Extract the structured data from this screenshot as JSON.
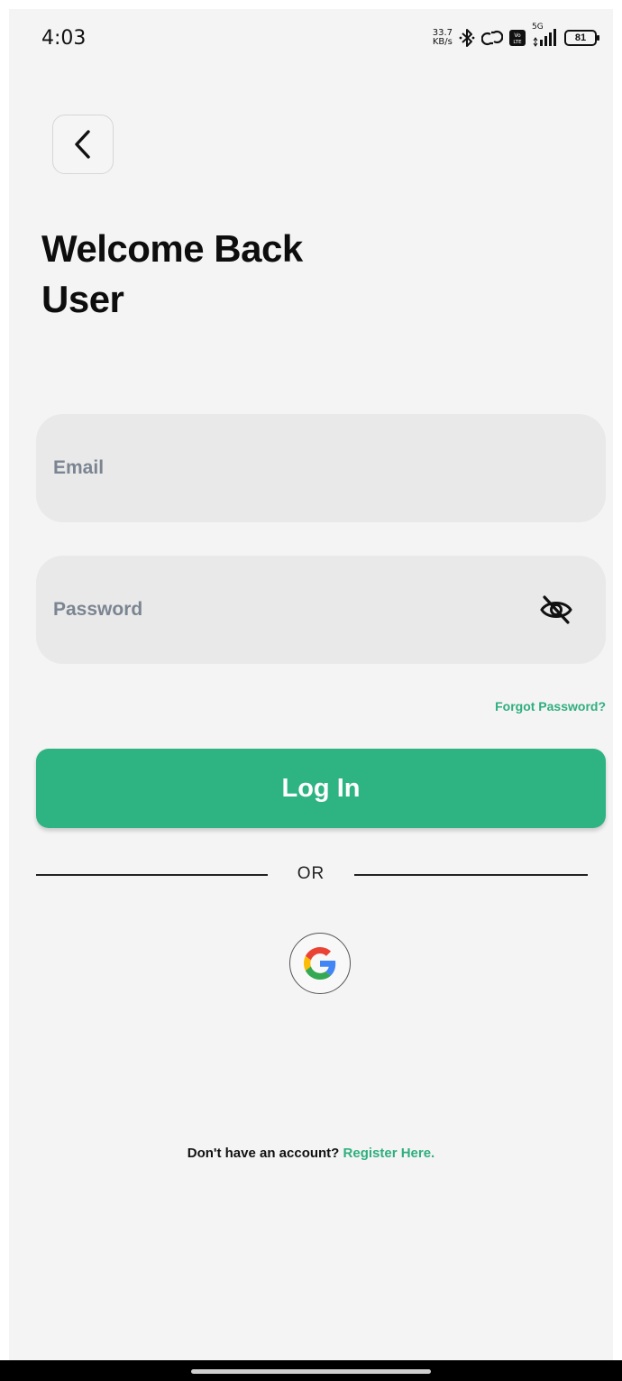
{
  "status_bar": {
    "time": "4:03",
    "net_speed_value": "33.7",
    "net_speed_unit": "KB/s",
    "signal_type": "5G",
    "battery": "81",
    "icons": [
      "bluetooth-icon",
      "hotspot-link-icon",
      "volte-icon",
      "signal-icon",
      "battery-icon"
    ]
  },
  "header": {
    "back_icon": "chevron-left-icon",
    "title_line1": "Welcome Back",
    "title_line2": "User"
  },
  "form": {
    "email_placeholder": "Email",
    "email_value": "",
    "password_placeholder": "Password",
    "password_value": "",
    "password_toggle_icon": "eye-off-icon",
    "forgot_password": "Forgot Password?",
    "login_label": "Log In"
  },
  "divider_text": "OR",
  "social": {
    "google_icon": "google-icon"
  },
  "footer": {
    "prompt": "Don't have an account? ",
    "register_link": "Register Here."
  },
  "colors": {
    "accent": "#2eb383",
    "link": "#2fae7f",
    "field_bg": "#e9e9e9",
    "background": "#f4f4f4",
    "placeholder": "#7b8591"
  }
}
